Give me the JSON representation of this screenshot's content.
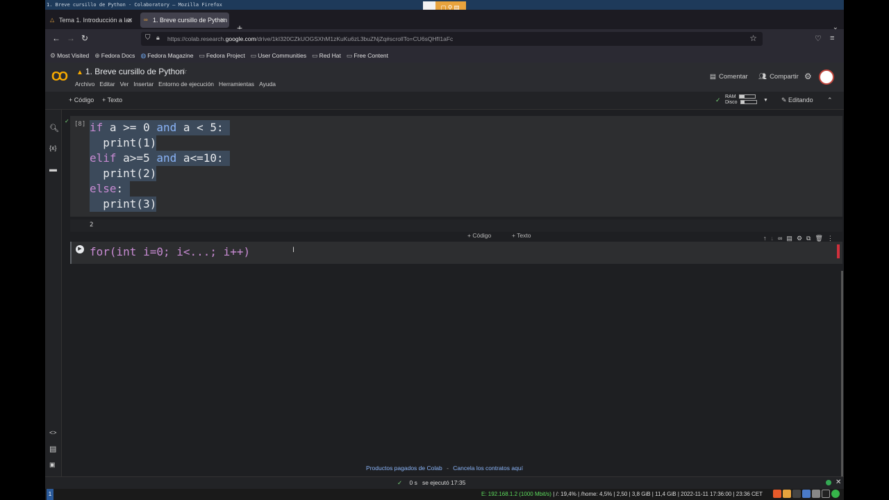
{
  "window": {
    "title": "1. Breve cursillo de Python - Colaboratory — Mozilla Firefox"
  },
  "tabs": [
    {
      "label": "Tema 1. Introducción a las",
      "active": false
    },
    {
      "label": "1. Breve cursillo de Python",
      "active": true
    }
  ],
  "nav": {
    "url_prefix": "https://colab.research.",
    "url_domain": "google.com",
    "url_suffix": "/drive/1kI320CZkUOGSXhM1zKuKu6zL3buZNjZq#scrollTo=CU6sQHfI1aFc"
  },
  "bookmarks": [
    {
      "label": "Most Visited",
      "icon": "gear-icon"
    },
    {
      "label": "Fedora Docs",
      "icon": "globe-icon"
    },
    {
      "label": "Fedora Magazine",
      "icon": "fedora-icon"
    },
    {
      "label": "Fedora Project",
      "icon": "folder-icon"
    },
    {
      "label": "User Communities",
      "icon": "folder-icon"
    },
    {
      "label": "Red Hat",
      "icon": "folder-icon"
    },
    {
      "label": "Free Content",
      "icon": "folder-icon"
    }
  ],
  "colab": {
    "logo": "CO",
    "notebook_title": "1. Breve cursillo de Python",
    "menu": [
      "Archivo",
      "Editar",
      "Ver",
      "Insertar",
      "Entorno de ejecución",
      "Herramientas",
      "Ayuda"
    ],
    "comment_label": "Comentar",
    "share_label": "Compartir"
  },
  "toolbar": {
    "add_code": "Código",
    "add_text": "Texto",
    "ram_label": "RAM",
    "disk_label": "Disco",
    "ram_usage": 0.35,
    "disk_usage": 0.25,
    "editing_label": "Editando"
  },
  "cells": {
    "cell1": {
      "execution_count": "[8]",
      "output": "2"
    },
    "cell2": {
      "code": "for(int i=0; i<...; i++)"
    }
  },
  "add_cell_bar": {
    "code": "Código",
    "text": "Texto"
  },
  "footer": {
    "link1": "Productos pagados de Colab",
    "separator": "-",
    "link2": "Cancela los contratos aquí"
  },
  "status": {
    "duration": "0 s",
    "executed_at": "se ejecutó 17:35"
  },
  "system_panel": {
    "workspace": "1",
    "network": "E: 192.168.1.2 (1000 Mbit/s)",
    "stats": "| /: 19,4% | /home: 4,5% | 2,50 | 3,8 GiB | 11,4 GiB | 2022-11-11 17:36:00 | 23:36 CET"
  },
  "colors": {
    "accent": "#f9ab00",
    "keyword": "#c88bd3",
    "operator_keyword": "#8ab4f8",
    "link": "#8ab4f8"
  }
}
